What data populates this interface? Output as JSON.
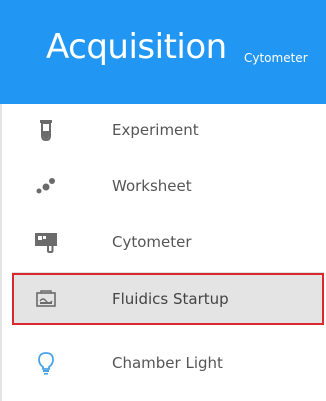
{
  "header": {
    "title": "Acquisition",
    "subtitle": "Cytometer",
    "background": "#2196f3"
  },
  "menu": {
    "items": [
      {
        "label": "Experiment",
        "icon": "test-tube-icon"
      },
      {
        "label": "Worksheet",
        "icon": "scatter-dots-icon"
      },
      {
        "label": "Cytometer",
        "icon": "cytometer-icon"
      },
      {
        "label": "Fluidics Startup",
        "icon": "fluidics-icon",
        "selected": true
      },
      {
        "label": "Chamber Light",
        "icon": "lightbulb-icon"
      }
    ],
    "selected_outline_color": "#d9282f",
    "selected_background": "#e4e4e4",
    "bulb_color": "#4aa3e8"
  }
}
